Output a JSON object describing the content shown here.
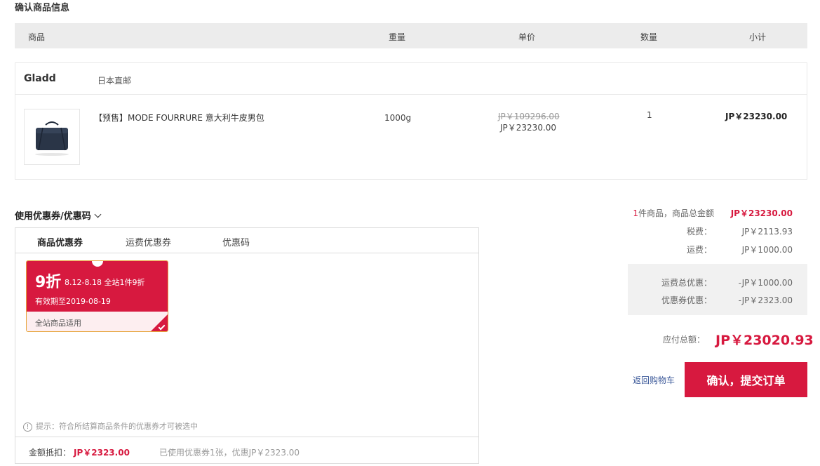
{
  "section_title": "确认商品信息",
  "table_header": {
    "product": "商品",
    "weight": "重量",
    "unit_price": "单价",
    "quantity": "数量",
    "subtotal": "小计"
  },
  "shop": {
    "name": "Gladd",
    "tag": "日本直邮"
  },
  "product": {
    "name": "【预售】MODE FOURRURE 意大利牛皮男包",
    "weight": "1000g",
    "original_price": "JP￥109296.00",
    "price": "JP￥23230.00",
    "quantity": "1",
    "subtotal": "JP￥23230.00",
    "thumb_icon": "bag-image"
  },
  "coupon_toggle": "使用优惠券/优惠码",
  "coupon_tabs": [
    {
      "label": "商品优惠券",
      "active": true
    },
    {
      "label": "运费优惠券",
      "active": false
    },
    {
      "label": "优惠码",
      "active": false
    }
  ],
  "coupon_card": {
    "discount": "9折",
    "rule": "8.12-8.18 全站1件9折",
    "expire": "有效期至2019-08-19",
    "scope": "全站商品适用",
    "selected": true
  },
  "panel_hint": "提示：符合所结算商品条件的优惠券才可被选中",
  "panel_footer": {
    "deduct_label": "金额抵扣：",
    "deduct_value": "JP￥2323.00",
    "note": "已使用优惠券1张，优惠JP￥2323.00"
  },
  "summary": {
    "items_count": "1",
    "items_label": "件商品，商品总金额",
    "items_total": "JP￥23230.00",
    "tax_label": "税费：",
    "tax_value": "JP￥2113.93",
    "shipping_label": "运费：",
    "shipping_value": "JP￥1000.00",
    "shipping_discount_label": "运费总优惠：",
    "shipping_discount_value": "-JP￥1000.00",
    "coupon_discount_label": "优惠券优惠：",
    "coupon_discount_value": "-JP￥2323.00",
    "total_label": "应付总额：",
    "total_value": "JP￥23020.93"
  },
  "actions": {
    "back_label": "返回购物车",
    "submit_label": "确认，提交订单"
  },
  "colors": {
    "accent": "#d7193f",
    "header_bg": "#ececec"
  }
}
